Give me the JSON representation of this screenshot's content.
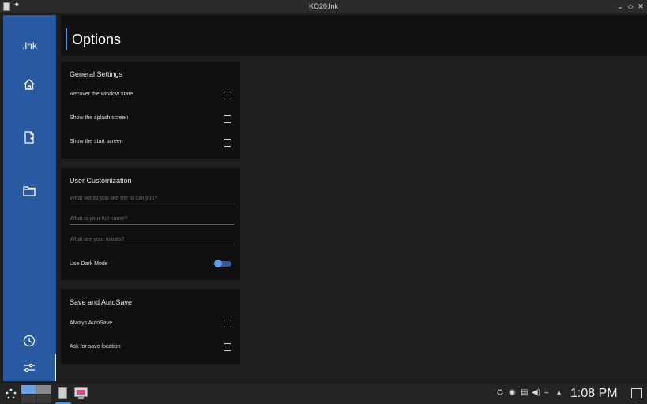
{
  "window": {
    "title": "KO20.lnk",
    "icons": {
      "app": "app-icon",
      "pin": "pin-icon",
      "minimize": "chevron-down-icon",
      "maximize": "diamond-icon",
      "close": "close-icon"
    }
  },
  "sidebar": {
    "brand": ".lnk",
    "color": "#2959a0",
    "items": [
      {
        "name": "home",
        "icon": "home-icon"
      },
      {
        "name": "new-document",
        "icon": "new-file-icon"
      },
      {
        "name": "folder",
        "icon": "folder-icon"
      },
      {
        "name": "history",
        "icon": "history-icon"
      },
      {
        "name": "settings",
        "icon": "sliders-icon"
      }
    ]
  },
  "header": {
    "title": "Options",
    "accent": "#4c8fe0"
  },
  "general_settings": {
    "title": "General Settings",
    "items": [
      {
        "label": "Recover the window state",
        "checked": false
      },
      {
        "label": "Show the splash screen",
        "checked": false
      },
      {
        "label": "Show the start screen",
        "checked": false
      }
    ]
  },
  "user_customization": {
    "title": "User Customization",
    "fields": [
      {
        "placeholder": "What would you like me to call you?",
        "value": ""
      },
      {
        "placeholder": "What is your full name?",
        "value": ""
      },
      {
        "placeholder": "What are your initials?",
        "value": ""
      }
    ],
    "dark_mode": {
      "label": "Use Dark Mode",
      "enabled": false
    }
  },
  "save_autosave": {
    "title": "Save and AutoSave",
    "items": [
      {
        "label": "Always AutoSave",
        "checked": false
      },
      {
        "label": "Ask for save location",
        "checked": false
      }
    ]
  },
  "taskbar": {
    "clock": "1:08 PM",
    "icons": [
      "app-launcher-icon",
      "pager-icon",
      "task-lnk-icon",
      "task-app-icon",
      "network-tray-icon",
      "discord-icon",
      "clipboard-icon",
      "volume-icon",
      "wifi-icon",
      "tray-expand-icon",
      "show-desktop-icon"
    ]
  }
}
